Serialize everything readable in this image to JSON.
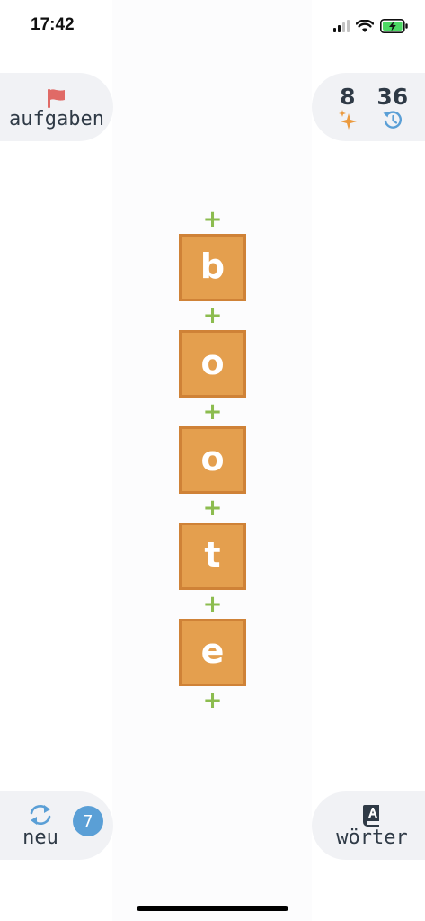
{
  "status_bar": {
    "time": "17:42"
  },
  "toolbar": {
    "tasks_label": "aufgaben",
    "new_label": "neu",
    "new_badge": "7",
    "words_label": "wörter"
  },
  "stats": {
    "stars": "8",
    "history": "36"
  },
  "word": {
    "letters": [
      "b",
      "o",
      "o",
      "t",
      "e"
    ],
    "insert_symbol": "+"
  },
  "colors": {
    "tile_fill": "#e49f4e",
    "tile_border": "#cf8237",
    "plus": "#8cbc4f",
    "flag": "#e06a66",
    "accent_blue": "#5a9fd6",
    "star": "#eb9a3e"
  },
  "icons": {
    "tasks": "flag-icon",
    "stars": "sparkle-icon",
    "history": "history-icon",
    "new": "refresh-icon",
    "words": "dictionary-icon"
  }
}
